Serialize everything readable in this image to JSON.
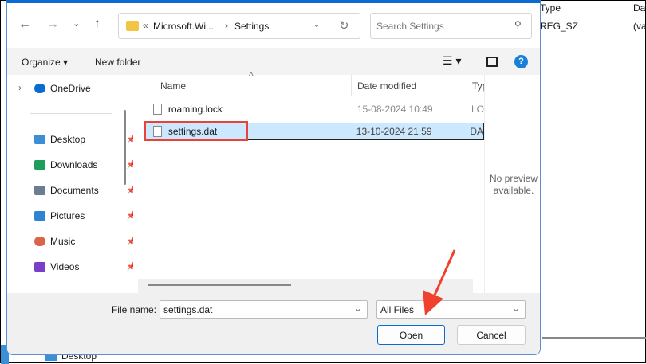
{
  "background": {
    "col_type": "Type",
    "col_data": "Dat",
    "row_type": "REG_SZ",
    "row_data": "(va",
    "taskbar_item": "Desktop"
  },
  "address": {
    "overflow": "«",
    "crumbs": [
      "Microsoft.Wi...",
      "Settings"
    ]
  },
  "search": {
    "placeholder": "Search Settings"
  },
  "toolbar": {
    "organize": "Organize ▾",
    "new_folder": "New folder",
    "help": "?"
  },
  "nav": {
    "items": [
      {
        "label": "OneDrive",
        "icon": "cloud-icon",
        "color": "#0a6cd0"
      },
      {
        "label": "Desktop",
        "icon": "desktop-icon",
        "color": "#3a8fd6"
      },
      {
        "label": "Downloads",
        "icon": "download-icon",
        "color": "#1e9e5a"
      },
      {
        "label": "Documents",
        "icon": "documents-icon",
        "color": "#6b7c93"
      },
      {
        "label": "Pictures",
        "icon": "pictures-icon",
        "color": "#2f83d4"
      },
      {
        "label": "Music",
        "icon": "music-icon",
        "color": "#d9664b"
      },
      {
        "label": "Videos",
        "icon": "videos-icon",
        "color": "#7a3ec9"
      }
    ]
  },
  "columns": {
    "name": "Name",
    "date": "Date modified",
    "type": "Typ"
  },
  "files": [
    {
      "name": "roaming.lock",
      "date": "15-08-2024 10:49",
      "type": "LO"
    },
    {
      "name": "settings.dat",
      "date": "13-10-2024 21:59",
      "type": "DA",
      "selected": true
    }
  ],
  "preview": "No preview available.",
  "footer": {
    "file_name_label": "File name:",
    "file_name_value": "settings.dat",
    "filter": "All Files",
    "open": "Open",
    "cancel": "Cancel"
  },
  "colors": {
    "accent": "#0a6cd0",
    "selection": "#cce8ff",
    "annotation": "#f0412e"
  }
}
